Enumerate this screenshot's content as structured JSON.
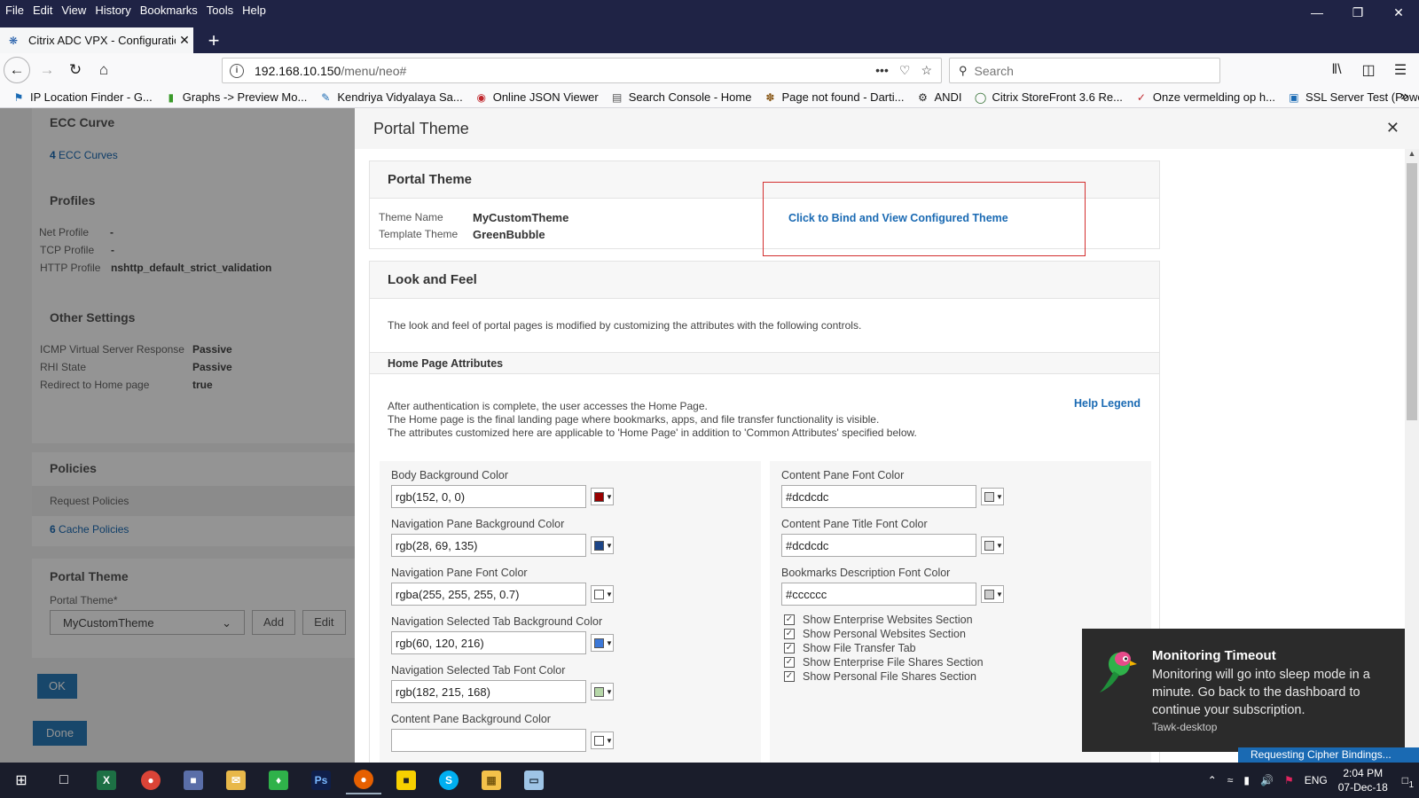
{
  "browser": {
    "menu": [
      "File",
      "Edit",
      "View",
      "History",
      "Bookmarks",
      "Tools",
      "Help"
    ],
    "tab_title": "Citrix ADC VPX - Configuration",
    "url_host": "192.168.10.150",
    "url_path": "/menu/neo#",
    "search_placeholder": "Search",
    "bookmarks": [
      "IP Location Finder - G...",
      "Graphs -> Preview Mo...",
      "Kendriya Vidyalaya Sa...",
      "Online JSON Viewer",
      "Search Console - Home",
      "Page not found - Darti...",
      "ANDI",
      "Citrix StoreFront 3.6 Re...",
      "Onze vermelding op h...",
      "SSL Server Test (Power..."
    ]
  },
  "background": {
    "ecc_title": "ECC Curve",
    "ecc_count": "4",
    "ecc_label": "ECC Curves",
    "profiles_title": "Profiles",
    "net_profile": "Net Profile",
    "tcp_profile": "TCP Profile",
    "http_profile": "HTTP Profile",
    "dash": "-",
    "http_profile_value": "nshttp_default_strict_validation",
    "other_title": "Other Settings",
    "icmp_label": "ICMP Virtual Server Response",
    "icmp_value": "Passive",
    "rhi_label": "RHI State",
    "rhi_value": "Passive",
    "redirect_label": "Redirect to Home page",
    "redirect_value": "true",
    "policies_title": "Policies",
    "request_policies": "Request Policies",
    "cache_count": "6",
    "cache_label": "Cache Policies",
    "portal_title": "Portal Theme",
    "portal_label": "Portal Theme*",
    "portal_value": "MyCustomTheme",
    "add": "Add",
    "edit": "Edit",
    "ok": "OK",
    "done": "Done"
  },
  "panel": {
    "title": "Portal Theme",
    "portal_theme": {
      "header": "Portal Theme",
      "theme_name_label": "Theme Name",
      "theme_name": "MyCustomTheme",
      "template_label": "Template Theme",
      "template": "GreenBubble",
      "bind_link": "Click to Bind and View Configured Theme"
    },
    "look_and_feel": {
      "header": "Look and Feel",
      "description": "The look and feel of portal pages is modified by customizing the attributes with the following controls.",
      "home_header": "Home Page Attributes",
      "home_desc_1": "After authentication is complete, the user accesses the Home Page.",
      "home_desc_2": "The Home page is the final landing page where bookmarks, apps, and file transfer functionality is visible.",
      "home_desc_3": "The attributes customized here are applicable to 'Home Page' in addition to 'Common Attributes' specified below.",
      "help_legend": "Help Legend"
    },
    "left_fields": [
      {
        "label": "Body Background Color",
        "value": "rgb(152, 0, 0)",
        "swatch": "#980000"
      },
      {
        "label": "Navigation Pane Background Color",
        "value": "rgb(28, 69, 135)",
        "swatch": "#1c4587"
      },
      {
        "label": "Navigation Pane Font Color",
        "value": "rgba(255, 255, 255, 0.7)",
        "swatch": "#ffffff"
      },
      {
        "label": "Navigation Selected Tab Background Color",
        "value": "rgb(60, 120, 216)",
        "swatch": "#3c78d8"
      },
      {
        "label": "Navigation Selected Tab Font Color",
        "value": "rgb(182, 215, 168)",
        "swatch": "#b6d7a8"
      },
      {
        "label": "Content Pane Background Color",
        "value": "",
        "swatch": "#ffffff"
      }
    ],
    "right_fields": [
      {
        "label": "Content Pane Font Color",
        "value": "#dcdcdc",
        "swatch": "#dcdcdc"
      },
      {
        "label": "Content Pane Title Font Color",
        "value": "#dcdcdc",
        "swatch": "#dcdcdc"
      },
      {
        "label": "Bookmarks Description Font Color",
        "value": "#cccccc",
        "swatch": "#cccccc"
      }
    ],
    "checkboxes": [
      "Show Enterprise Websites Section",
      "Show Personal Websites Section",
      "Show File Transfer Tab",
      "Show Enterprise File Shares Section",
      "Show Personal File Shares Section"
    ]
  },
  "toast": {
    "title": "Monitoring Timeout",
    "body": "Monitoring will go into sleep mode in a minute. Go back to the dashboard to continue your subscription.",
    "app": "Tawk-desktop"
  },
  "status_strip": "Requesting Cipher Bindings...",
  "taskbar": {
    "lang": "ENG",
    "time": "2:04 PM",
    "date": "07-Dec-18",
    "notif_count": "1"
  }
}
